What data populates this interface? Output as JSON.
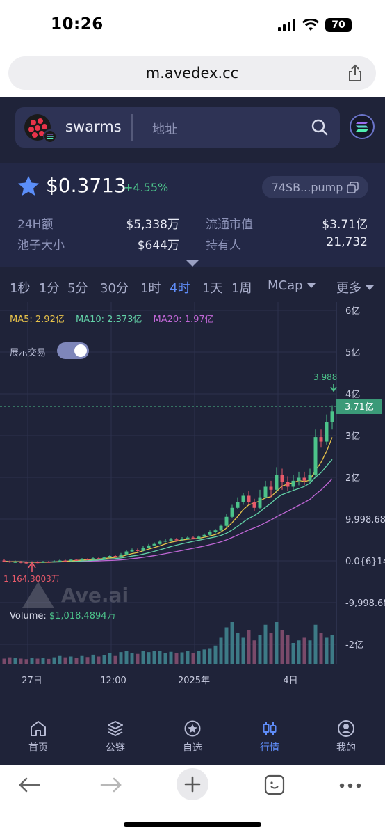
{
  "status_bar": {
    "time": "10:26",
    "battery": "70"
  },
  "browser": {
    "url": "m.avedex.cc"
  },
  "search": {
    "token_name": "swarms",
    "placeholder": "地址"
  },
  "token": {
    "price": "$0.3713",
    "change": "+4.55%",
    "address": "74SB...pump",
    "stats": [
      {
        "label": "24H额",
        "value": "$5,338万"
      },
      {
        "label": "流通市值",
        "value": "$3.71亿"
      },
      {
        "label": "池子大小",
        "value": "$644万"
      },
      {
        "label": "持有人",
        "value": "21,732"
      }
    ]
  },
  "timeframes": [
    "1秒",
    "1分",
    "5分",
    "30分",
    "1时",
    "4时",
    "1天",
    "1周"
  ],
  "active_timeframe": "4时",
  "mcap_label": "MCap",
  "more_label": "更多",
  "chart_overlay": {
    "ma5": "MA5: 2.92亿",
    "ma10": "MA10: 2.373亿",
    "ma20": "MA20: 1.97亿",
    "toggle_label": "展示交易",
    "watermark": "Ave.ai",
    "volume_label": "Volume: ",
    "volume_value": "$1,018.4894万",
    "current_price_tag": "3.71亿",
    "high_marker": "3.988",
    "low_marker": "1,164.3003万"
  },
  "colors": {
    "up": "#4cc38a",
    "down": "#e85a6a",
    "ma5": "#e7c24a",
    "ma10": "#62d1a7",
    "ma20": "#c067d6",
    "accent": "#5f8dfa"
  },
  "chart_data": {
    "type": "candlestick",
    "y_axis_labels": [
      "6亿",
      "5亿",
      "4亿",
      "3亿",
      "2亿",
      "9,998.68",
      "0.0{6}14",
      "-9,998.68",
      "-2亿"
    ],
    "x_axis_labels": [
      "27日",
      "12:00",
      "2025年",
      "4日"
    ],
    "candles": [
      {
        "o": 0.13,
        "c": 0.125,
        "h": 0.14,
        "l": 0.12
      },
      {
        "o": 0.125,
        "c": 0.12,
        "h": 0.13,
        "l": 0.115
      },
      {
        "o": 0.12,
        "c": 0.122,
        "h": 0.13,
        "l": 0.115
      },
      {
        "o": 0.122,
        "c": 0.118,
        "h": 0.128,
        "l": 0.112
      },
      {
        "o": 0.118,
        "c": 0.116,
        "h": 0.125,
        "l": 0.11
      },
      {
        "o": 0.116,
        "c": 0.12,
        "h": 0.125,
        "l": 0.11
      },
      {
        "o": 0.12,
        "c": 0.118,
        "h": 0.126,
        "l": 0.112
      },
      {
        "o": 0.118,
        "c": 0.122,
        "h": 0.128,
        "l": 0.115
      },
      {
        "o": 0.122,
        "c": 0.12,
        "h": 0.128,
        "l": 0.116
      },
      {
        "o": 0.12,
        "c": 0.125,
        "h": 0.132,
        "l": 0.116
      },
      {
        "o": 0.125,
        "c": 0.13,
        "h": 0.136,
        "l": 0.12
      },
      {
        "o": 0.13,
        "c": 0.128,
        "h": 0.135,
        "l": 0.122
      },
      {
        "o": 0.128,
        "c": 0.135,
        "h": 0.14,
        "l": 0.124
      },
      {
        "o": 0.135,
        "c": 0.132,
        "h": 0.14,
        "l": 0.128
      },
      {
        "o": 0.132,
        "c": 0.14,
        "h": 0.146,
        "l": 0.128
      },
      {
        "o": 0.14,
        "c": 0.138,
        "h": 0.145,
        "l": 0.133
      },
      {
        "o": 0.138,
        "c": 0.145,
        "h": 0.152,
        "l": 0.134
      },
      {
        "o": 0.145,
        "c": 0.142,
        "h": 0.15,
        "l": 0.138
      },
      {
        "o": 0.142,
        "c": 0.15,
        "h": 0.156,
        "l": 0.138
      },
      {
        "o": 0.15,
        "c": 0.16,
        "h": 0.168,
        "l": 0.146
      },
      {
        "o": 0.16,
        "c": 0.158,
        "h": 0.166,
        "l": 0.152
      },
      {
        "o": 0.158,
        "c": 0.17,
        "h": 0.18,
        "l": 0.154
      },
      {
        "o": 0.17,
        "c": 0.19,
        "h": 0.2,
        "l": 0.165
      },
      {
        "o": 0.19,
        "c": 0.2,
        "h": 0.21,
        "l": 0.185
      },
      {
        "o": 0.2,
        "c": 0.195,
        "h": 0.21,
        "l": 0.188
      },
      {
        "o": 0.195,
        "c": 0.215,
        "h": 0.225,
        "l": 0.19
      },
      {
        "o": 0.215,
        "c": 0.23,
        "h": 0.24,
        "l": 0.21
      },
      {
        "o": 0.23,
        "c": 0.24,
        "h": 0.25,
        "l": 0.225
      },
      {
        "o": 0.24,
        "c": 0.255,
        "h": 0.265,
        "l": 0.235
      },
      {
        "o": 0.255,
        "c": 0.262,
        "h": 0.272,
        "l": 0.25
      },
      {
        "o": 0.262,
        "c": 0.27,
        "h": 0.28,
        "l": 0.256
      },
      {
        "o": 0.27,
        "c": 0.266,
        "h": 0.28,
        "l": 0.26
      },
      {
        "o": 0.266,
        "c": 0.275,
        "h": 0.285,
        "l": 0.262
      },
      {
        "o": 0.275,
        "c": 0.282,
        "h": 0.292,
        "l": 0.27
      },
      {
        "o": 0.282,
        "c": 0.276,
        "h": 0.29,
        "l": 0.27
      },
      {
        "o": 0.276,
        "c": 0.288,
        "h": 0.296,
        "l": 0.272
      },
      {
        "o": 0.288,
        "c": 0.3,
        "h": 0.31,
        "l": 0.284
      },
      {
        "o": 0.3,
        "c": 0.318,
        "h": 0.33,
        "l": 0.295
      },
      {
        "o": 0.318,
        "c": 0.33,
        "h": 0.34,
        "l": 0.31
      },
      {
        "o": 0.33,
        "c": 0.36,
        "h": 0.37,
        "l": 0.325
      },
      {
        "o": 0.36,
        "c": 0.42,
        "h": 0.44,
        "l": 0.35
      },
      {
        "o": 0.42,
        "c": 0.48,
        "h": 0.5,
        "l": 0.41
      },
      {
        "o": 0.48,
        "c": 0.52,
        "h": 0.55,
        "l": 0.47
      },
      {
        "o": 0.52,
        "c": 0.56,
        "h": 0.58,
        "l": 0.5
      },
      {
        "o": 0.56,
        "c": 0.52,
        "h": 0.59,
        "l": 0.5
      },
      {
        "o": 0.52,
        "c": 0.48,
        "h": 0.54,
        "l": 0.46
      },
      {
        "o": 0.48,
        "c": 0.55,
        "h": 0.6,
        "l": 0.47
      },
      {
        "o": 0.55,
        "c": 0.62,
        "h": 0.66,
        "l": 0.54
      },
      {
        "o": 0.62,
        "c": 0.6,
        "h": 0.66,
        "l": 0.55
      },
      {
        "o": 0.6,
        "c": 0.7,
        "h": 0.75,
        "l": 0.58
      },
      {
        "o": 0.7,
        "c": 0.65,
        "h": 0.74,
        "l": 0.6
      },
      {
        "o": 0.65,
        "c": 0.62,
        "h": 0.69,
        "l": 0.59
      },
      {
        "o": 0.62,
        "c": 0.66,
        "h": 0.7,
        "l": 0.6
      },
      {
        "o": 0.66,
        "c": 0.68,
        "h": 0.72,
        "l": 0.63
      },
      {
        "o": 0.68,
        "c": 0.66,
        "h": 0.72,
        "l": 0.63
      },
      {
        "o": 0.66,
        "c": 0.7,
        "h": 0.74,
        "l": 0.64
      },
      {
        "o": 0.7,
        "c": 0.95,
        "h": 1.0,
        "l": 0.68
      },
      {
        "o": 0.95,
        "c": 0.92,
        "h": 1.0,
        "l": 0.88
      },
      {
        "o": 0.92,
        "c": 1.05,
        "h": 1.1,
        "l": 0.9
      },
      {
        "o": 1.05,
        "c": 1.12,
        "h": 1.16,
        "l": 1.0
      }
    ],
    "volumes": [
      0.2,
      0.25,
      0.22,
      0.2,
      0.18,
      0.24,
      0.2,
      0.22,
      0.19,
      0.25,
      0.3,
      0.25,
      0.28,
      0.24,
      0.3,
      0.26,
      0.35,
      0.28,
      0.32,
      0.4,
      0.3,
      0.45,
      0.5,
      0.4,
      0.38,
      0.5,
      0.45,
      0.48,
      0.5,
      0.42,
      0.46,
      0.4,
      0.44,
      0.48,
      0.42,
      0.5,
      0.55,
      0.6,
      0.7,
      1.0,
      1.4,
      1.6,
      1.2,
      1.0,
      1.3,
      0.9,
      1.1,
      1.5,
      1.2,
      1.6,
      1.3,
      1.1,
      0.8,
      0.9,
      1.0,
      0.9,
      1.5,
      1.2,
      1.0,
      1.1
    ],
    "volume_colors": [
      "down",
      "down",
      "up",
      "down",
      "down",
      "up",
      "down",
      "up",
      "down",
      "up",
      "up",
      "down",
      "up",
      "down",
      "up",
      "down",
      "up",
      "down",
      "up",
      "up",
      "down",
      "up",
      "up",
      "up",
      "down",
      "up",
      "up",
      "up",
      "up",
      "up",
      "up",
      "down",
      "up",
      "up",
      "down",
      "up",
      "up",
      "up",
      "up",
      "up",
      "up",
      "up",
      "up",
      "up",
      "down",
      "down",
      "up",
      "up",
      "down",
      "up",
      "down",
      "down",
      "up",
      "up",
      "down",
      "up",
      "up",
      "down",
      "up",
      "up"
    ]
  },
  "tabs": [
    {
      "label": "首页",
      "icon": "home-icon"
    },
    {
      "label": "公链",
      "icon": "layers-icon"
    },
    {
      "label": "自选",
      "icon": "star-circle-icon"
    },
    {
      "label": "行情",
      "icon": "candles-icon"
    },
    {
      "label": "我的",
      "icon": "user-icon"
    }
  ],
  "active_tab": "行情"
}
